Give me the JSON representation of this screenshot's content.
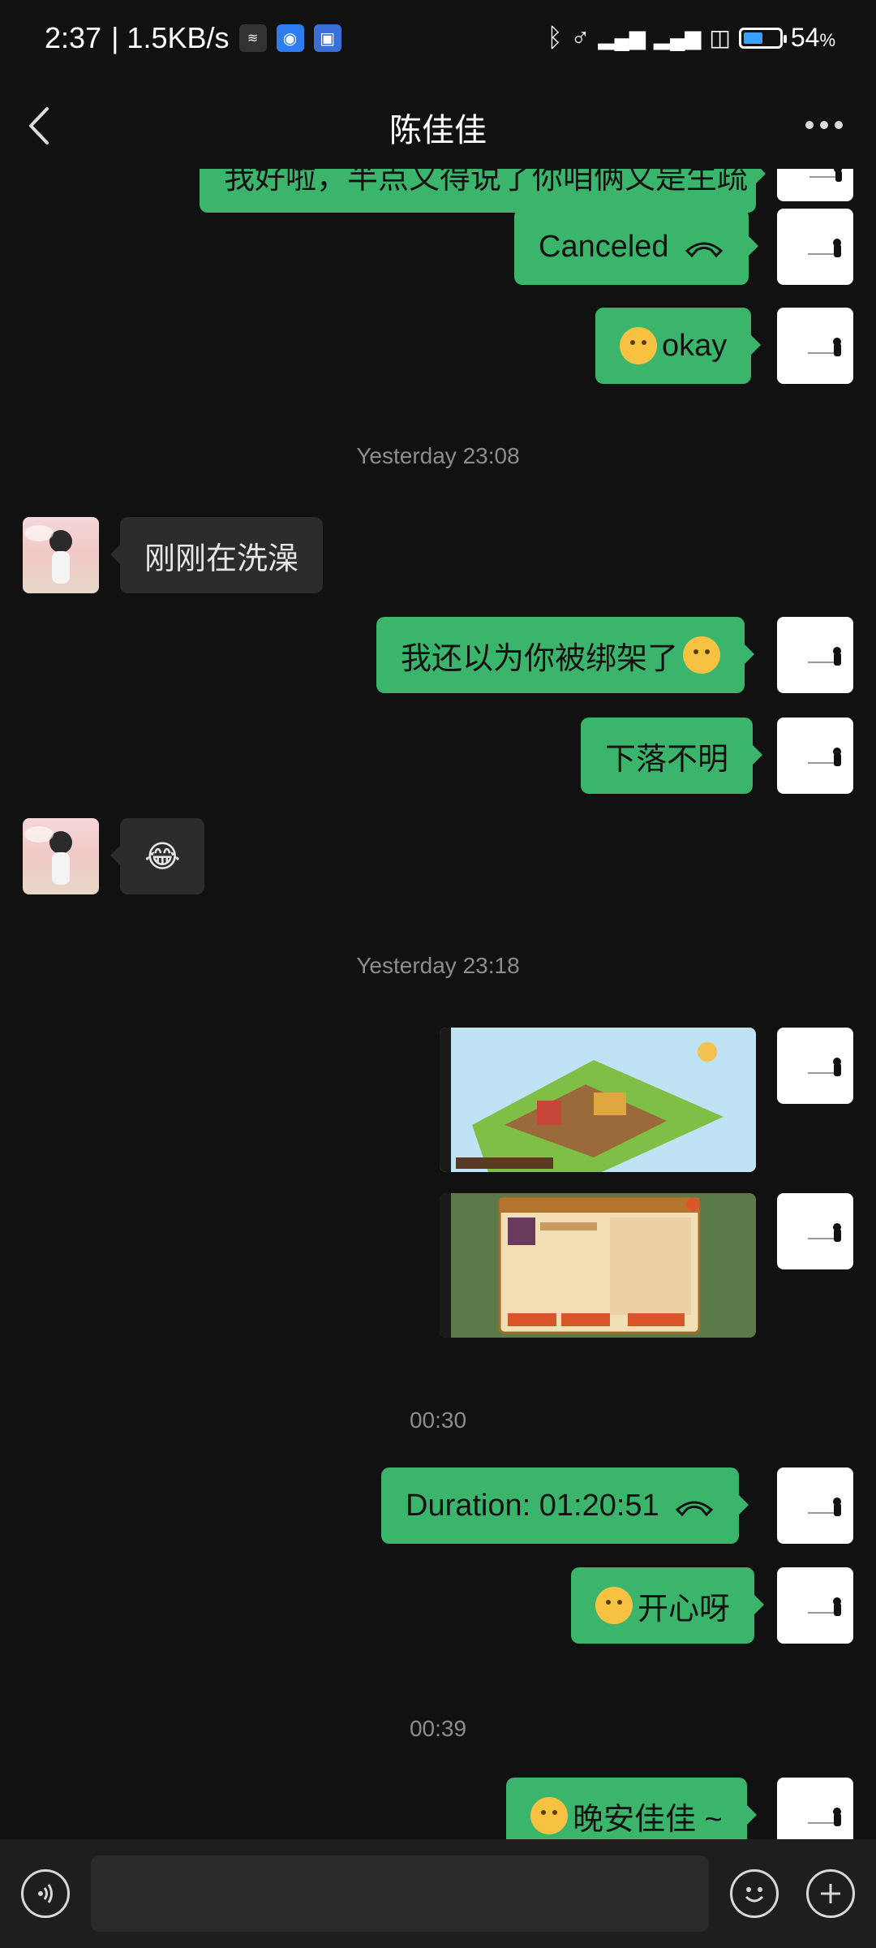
{
  "status_bar": {
    "time": "2:37",
    "network_speed": "| 1.5KB/s",
    "battery_percent": "54",
    "battery_unit": "%",
    "battery_level": 54
  },
  "header": {
    "title": "陈佳佳"
  },
  "messages": {
    "m0": "我好啦，半点又得说了你咱俩又是生疏",
    "m1": "Canceled",
    "m2": "okay",
    "ts1": "Yesterday 23:08",
    "m3": "刚刚在洗澡",
    "m4": "我还以为你被绑架了",
    "m5": "下落不明",
    "m6": "😂",
    "ts2": "Yesterday 23:18",
    "ts3": "00:30",
    "m7": "Duration: 01:20:51",
    "m8": "开心呀",
    "ts4": "00:39",
    "m9": "晚安佳佳 ~"
  },
  "icons": {
    "back": "chevron-left-icon",
    "more": "more-dots-icon",
    "voice": "voice-icon",
    "emoji": "emoji-icon",
    "add": "plus-icon",
    "call": "phone-hangup-icon"
  },
  "colors": {
    "outgoing_bubble": "#3cb56c",
    "incoming_bubble": "#2c2c2c",
    "background": "#111111",
    "battery_fill": "#3aa0ff"
  }
}
